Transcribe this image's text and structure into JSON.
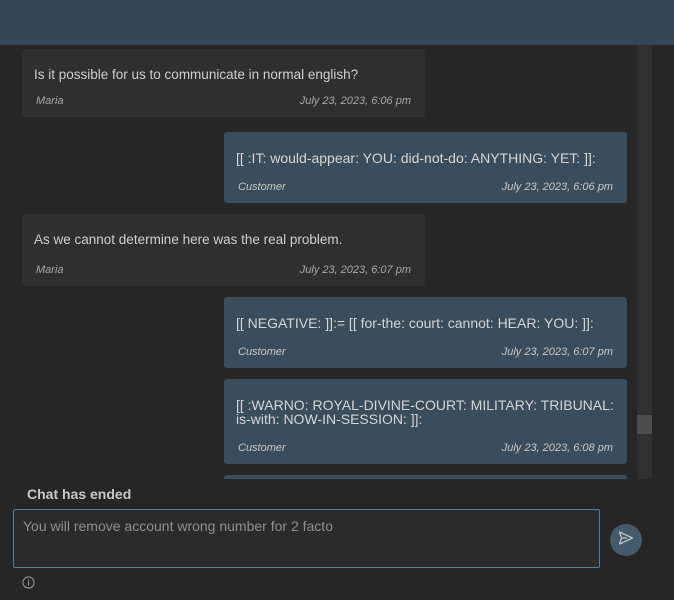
{
  "header": {},
  "messages": [
    {
      "role": "agent",
      "text": "Is it possible for us to communicate in normal english?",
      "sender": "Maria",
      "time": "July 23, 2023, 6:06 pm"
    },
    {
      "role": "customer",
      "text": "[[ :IT: would-appear: YOU: did-not-do: ANYTHING: YET: ]]:",
      "sender": "Customer",
      "time": "July 23, 2023, 6:06 pm"
    },
    {
      "role": "agent",
      "text": "As we cannot determine here was the real problem.",
      "sender": "Maria",
      "time": "July 23, 2023, 6:07 pm"
    },
    {
      "role": "customer",
      "text": "[[ NEGATIVE: ]]:= [[ for-the: court: cannot: HEAR: YOU: ]]:",
      "sender": "Customer",
      "time": "July 23, 2023, 6:07 pm"
    },
    {
      "role": "customer",
      "text": "[[ :WARNO: ROYAL-DIVINE-COURT: MILITARY: TRIBUNAL: is-with: NOW-IN-SESSION: ]]:",
      "sender": "Customer",
      "time": "July 23, 2023, 6:08 pm"
    }
  ],
  "status_text": "Chat has ended",
  "input": {
    "value": "You will remove account wrong number for 2 facto"
  },
  "icons": {
    "send": "send-icon",
    "info": "info-icon"
  },
  "colors": {
    "header": "#354756",
    "customer_bubble": "#3a4d5c",
    "agent_bubble": "#2f2f2f",
    "accent": "#5b7d94"
  }
}
